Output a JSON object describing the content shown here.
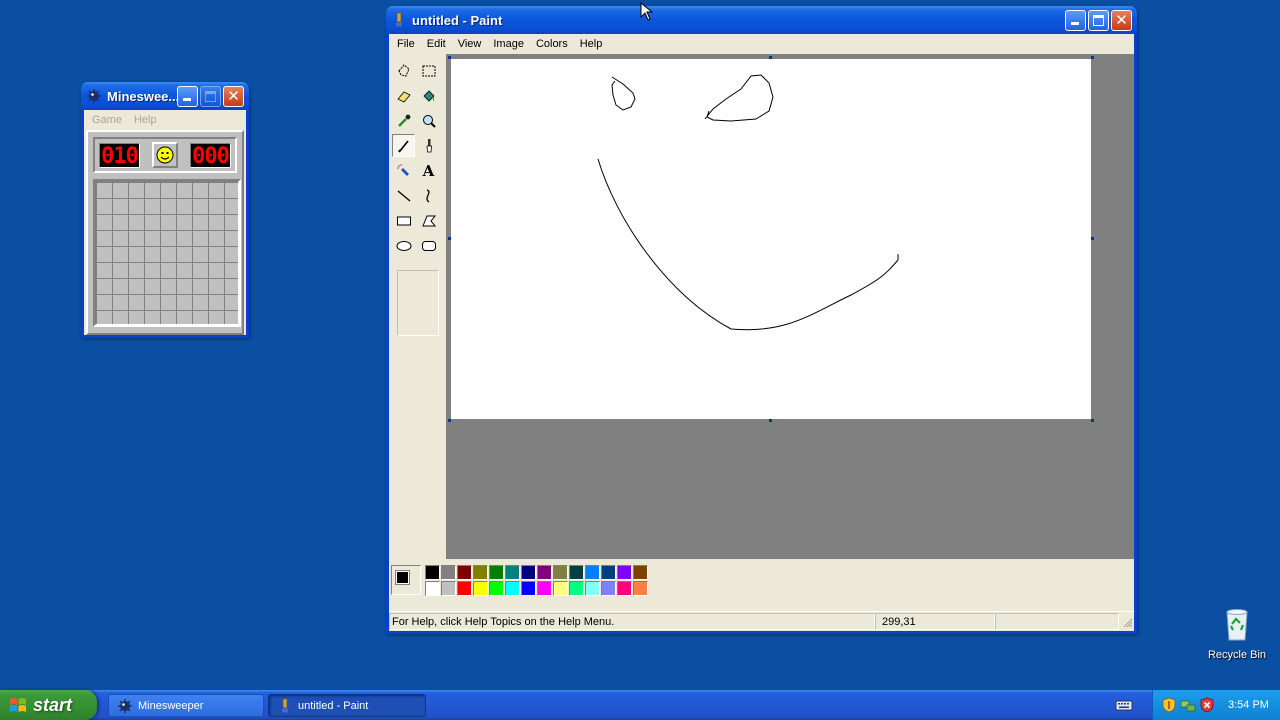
{
  "minesweeper": {
    "title": "Mineswee...",
    "menu": [
      "Game",
      "Help"
    ],
    "mines_counter": "010",
    "timer": "000"
  },
  "paint": {
    "title": "untitled - Paint",
    "menu": [
      "File",
      "Edit",
      "View",
      "Image",
      "Colors",
      "Help"
    ],
    "status_help": "For Help, click Help Topics on the Help Menu.",
    "status_coords": "299,31",
    "selected_tool": "pencil",
    "foreground_color": "#000000",
    "background_color": "#ffffff",
    "palette": [
      "#000000",
      "#808080",
      "#800000",
      "#808000",
      "#008000",
      "#008080",
      "#000080",
      "#800080",
      "#808040",
      "#004040",
      "#0080ff",
      "#004080",
      "#8000ff",
      "#804000",
      "#ffffff",
      "#c0c0c0",
      "#ff0000",
      "#ffff00",
      "#00ff00",
      "#00ffff",
      "#0000ff",
      "#ff00ff",
      "#ffff80",
      "#00ff80",
      "#80ffff",
      "#8080ff",
      "#ff0080",
      "#ff8040"
    ]
  },
  "desktop": {
    "recycle_bin_label": "Recycle Bin"
  },
  "taskbar": {
    "start_label": "start",
    "tasks": [
      "Minesweeper",
      "untitled - Paint"
    ],
    "clock": "3:54 PM"
  }
}
